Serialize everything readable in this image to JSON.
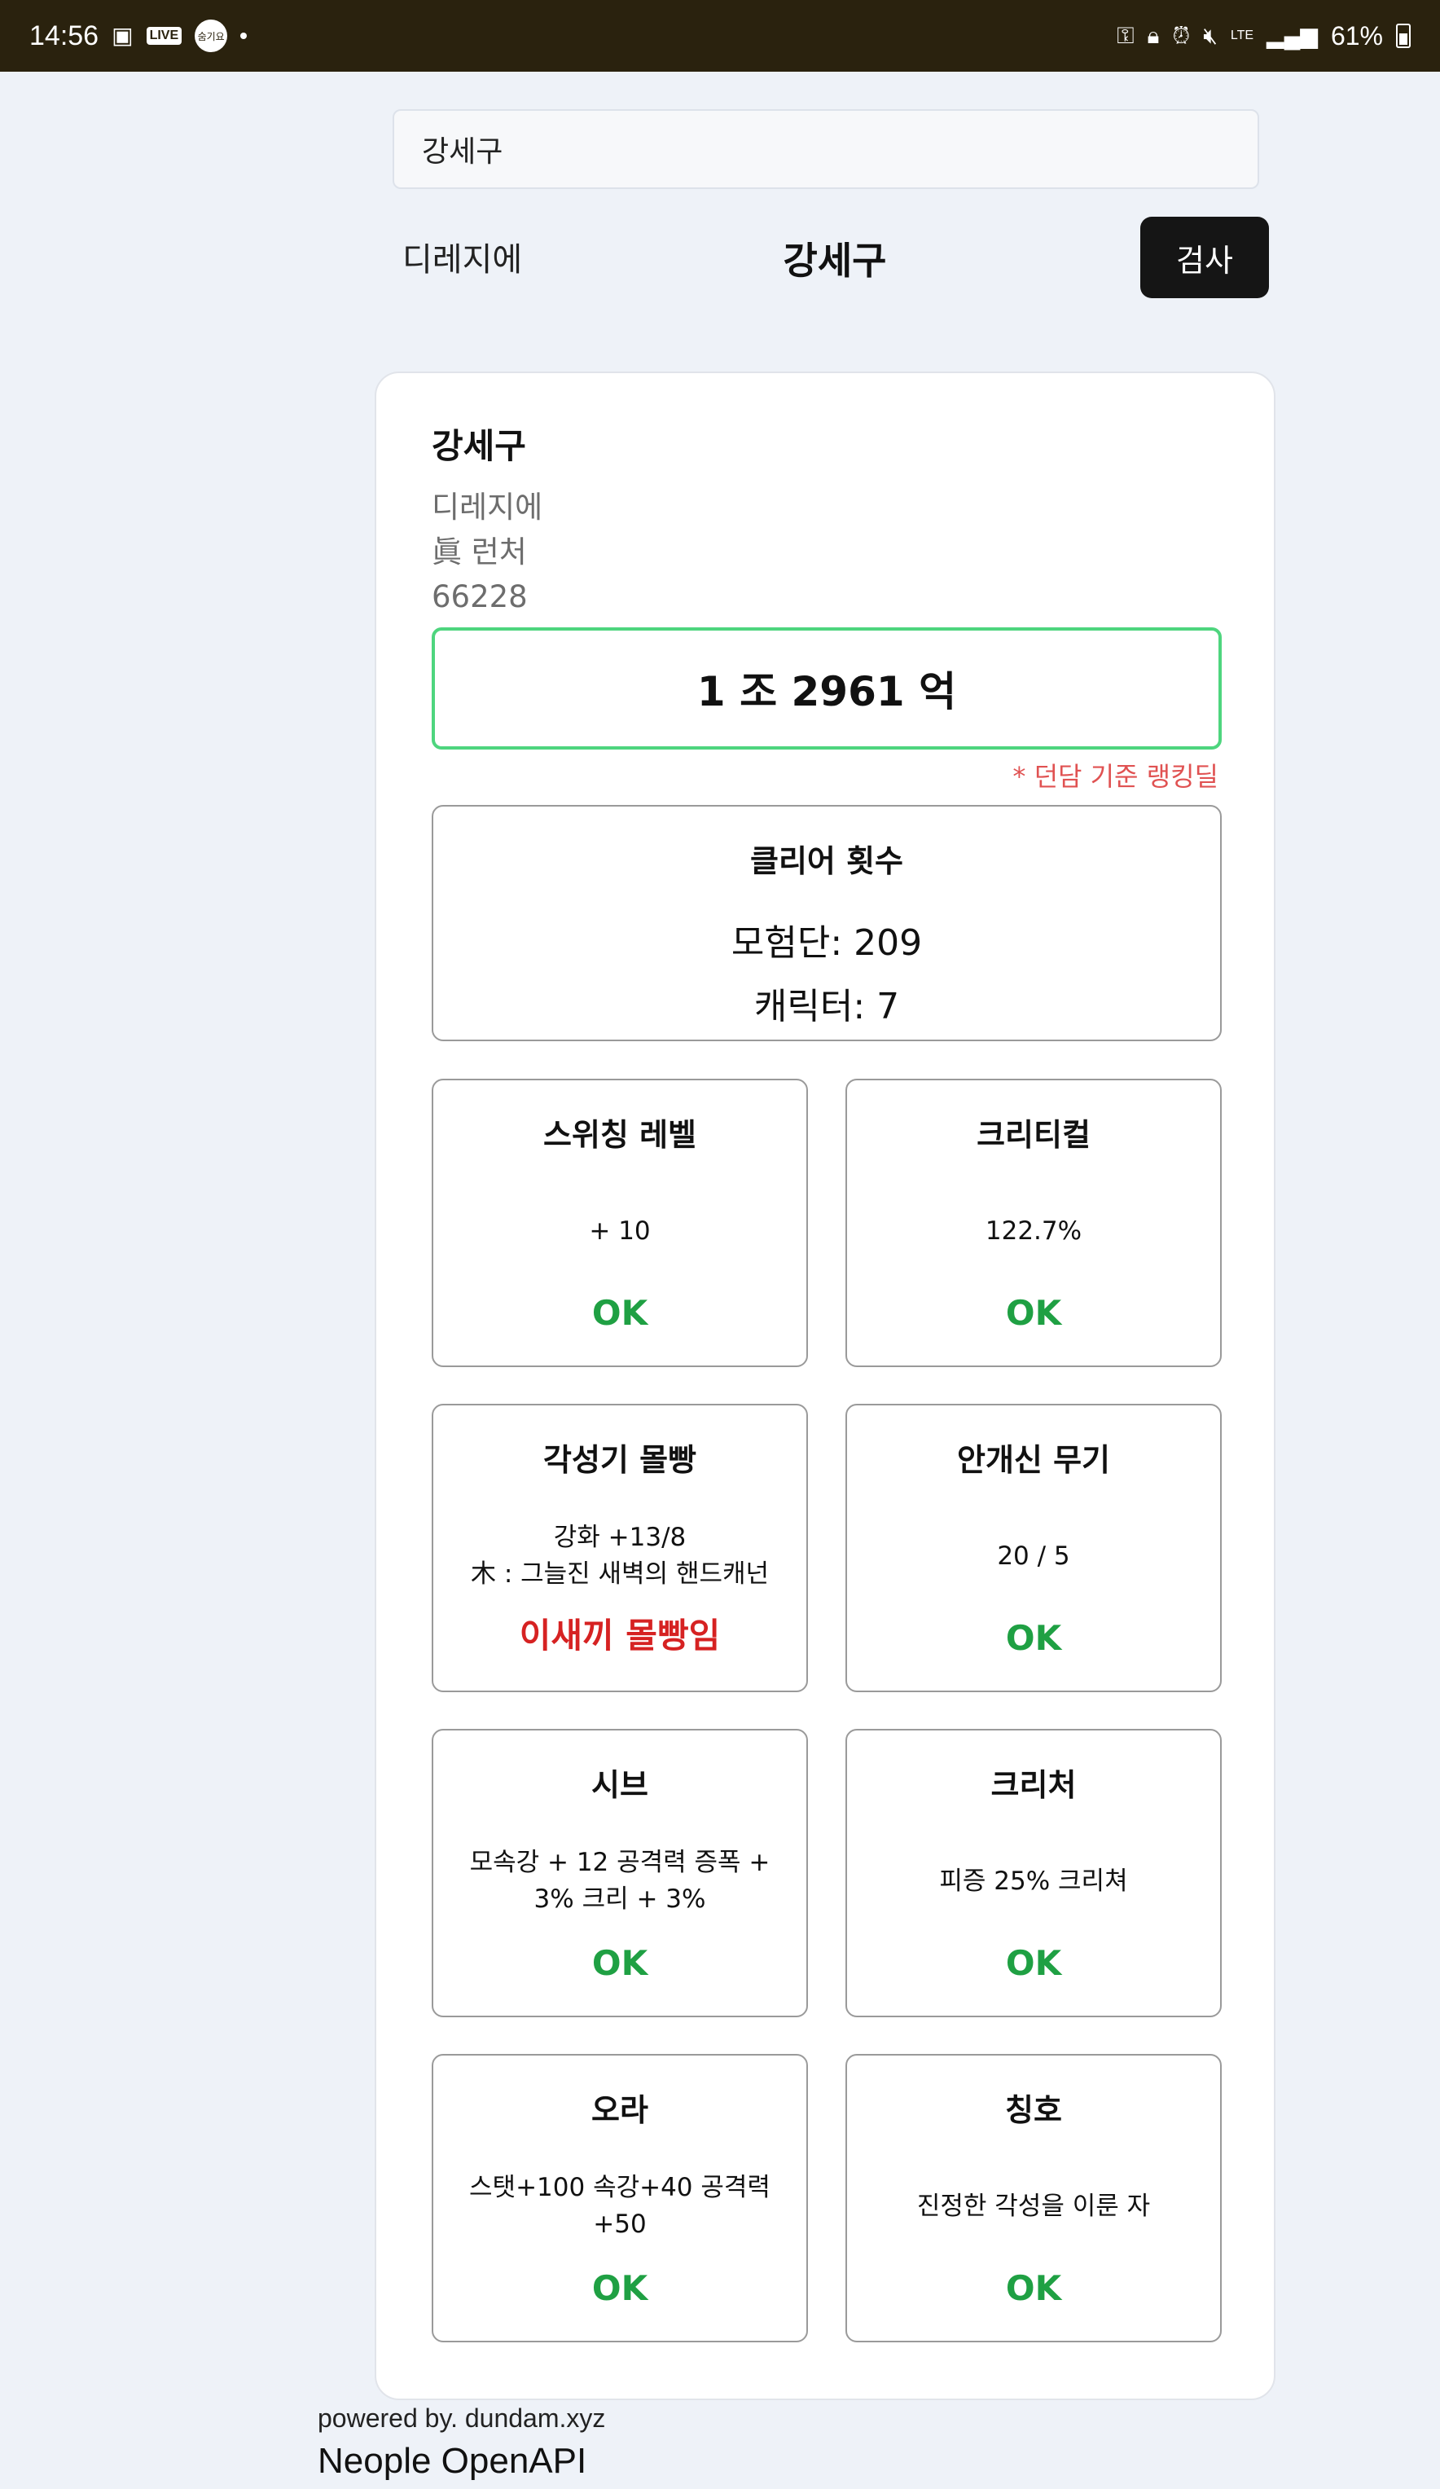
{
  "status_bar": {
    "time": "14:56",
    "left_badges": [
      "LIVE",
      "숨기요"
    ],
    "battery": "61%",
    "network": "LTE"
  },
  "search": {
    "value": "강세구"
  },
  "header": {
    "server": "디레지에",
    "character": "강세구",
    "check_button": "검사"
  },
  "card": {
    "name": "강세구",
    "server": "디레지에",
    "job": "眞 런처",
    "fame": "66228",
    "damage": "1 조 2961 억",
    "damage_note": "* 던담 기준 랭킹딜",
    "clear": {
      "title": "클리어 횟수",
      "adventure": "모험단: 209",
      "character": "캐릭터: 7"
    },
    "tiles": [
      {
        "title": "스위칭 레벨",
        "detail": "+ 10",
        "status": "OK",
        "ok": true
      },
      {
        "title": "크리티컬",
        "detail": "122.7%",
        "status": "OK",
        "ok": true
      },
      {
        "title": "각성기 몰빵",
        "detail": "강화 +13/8\n木 : 그늘진 새벽의 핸드캐넌",
        "status": "이새끼 몰빵임",
        "ok": false
      },
      {
        "title": "안개신 무기",
        "detail": "20 / 5",
        "status": "OK",
        "ok": true
      },
      {
        "title": "시브",
        "detail": "모속강 + 12 공격력 증폭 + 3% 크리 + 3%",
        "status": "OK",
        "ok": true
      },
      {
        "title": "크리처",
        "detail": "피증 25% 크리쳐",
        "status": "OK",
        "ok": true
      },
      {
        "title": "오라",
        "detail": "스탯+100 속강+40 공격력 +50",
        "status": "OK",
        "ok": true
      },
      {
        "title": "칭호",
        "detail": "진정한 각성을 이룬 자",
        "status": "OK",
        "ok": true
      }
    ]
  },
  "footer": {
    "powered": "powered by. dundam.xyz",
    "api": "Neople OpenAPI"
  }
}
